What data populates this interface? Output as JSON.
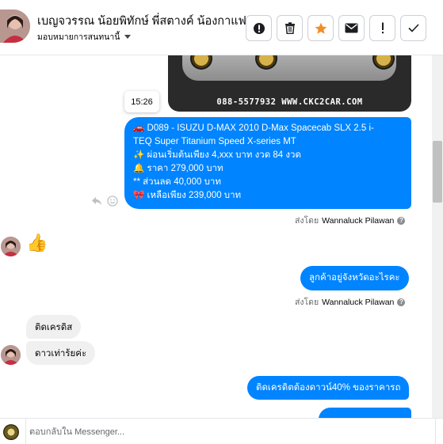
{
  "header": {
    "customer_name": "เบญจวรรณ น้อยพิทักษ์ พี่สตางค์ น้องกาแฟ",
    "assign_label": "มอบหมายการสนทนานี้",
    "actions": [
      {
        "name": "alert-button",
        "icon": "exclamation-circle-icon"
      },
      {
        "name": "delete-button",
        "icon": "trash-icon"
      },
      {
        "name": "star-button",
        "icon": "star-icon",
        "active_color": "#f28c28"
      },
      {
        "name": "unread-button",
        "icon": "envelope-icon"
      },
      {
        "name": "spam-button",
        "icon": "exclamation-icon"
      },
      {
        "name": "done-button",
        "icon": "check-icon"
      }
    ]
  },
  "chat": {
    "image_watermark": "088-5577932 WWW.CKC2CAR.COM",
    "timestamp": "15:26",
    "listing_message": {
      "lines": [
        "🚗 D089 - ISUZU D-MAX 2010 D-Max Spacecab SLX 2.5 i-",
        "TEQ Super Titanium Speed X-series MT",
        "✨ ผ่อนเริ่มต้นเพียง 4,xxx บาท งวด 84 งวด",
        "🔔 ราคา 279,000 บาท",
        "** ส่วนลด 40,000 บาท",
        "🎀 เหลือเพียง 239,000 บาท"
      ]
    },
    "sent_by_prefix": "ส่งโดย",
    "sent_by_name": "Wannaluck Pilawan",
    "thumbs_up": "👍",
    "question_message": "ลูกค้าอยู่จังหวัดอะไรคะ",
    "customer_reply_1": "ติดเครดิส",
    "customer_reply_2": "ดาวเท่าร้ยค่ะ",
    "answer_message": "ติดเครดิตต้องดาวน์40% ของราคารถ"
  },
  "footer": {
    "reply_placeholder": "ตอบกลับใน Messenger..."
  },
  "colors": {
    "outgoing_bubble": "#0084ff",
    "incoming_bubble": "#f0f0f0",
    "star_active": "#f28c28"
  }
}
